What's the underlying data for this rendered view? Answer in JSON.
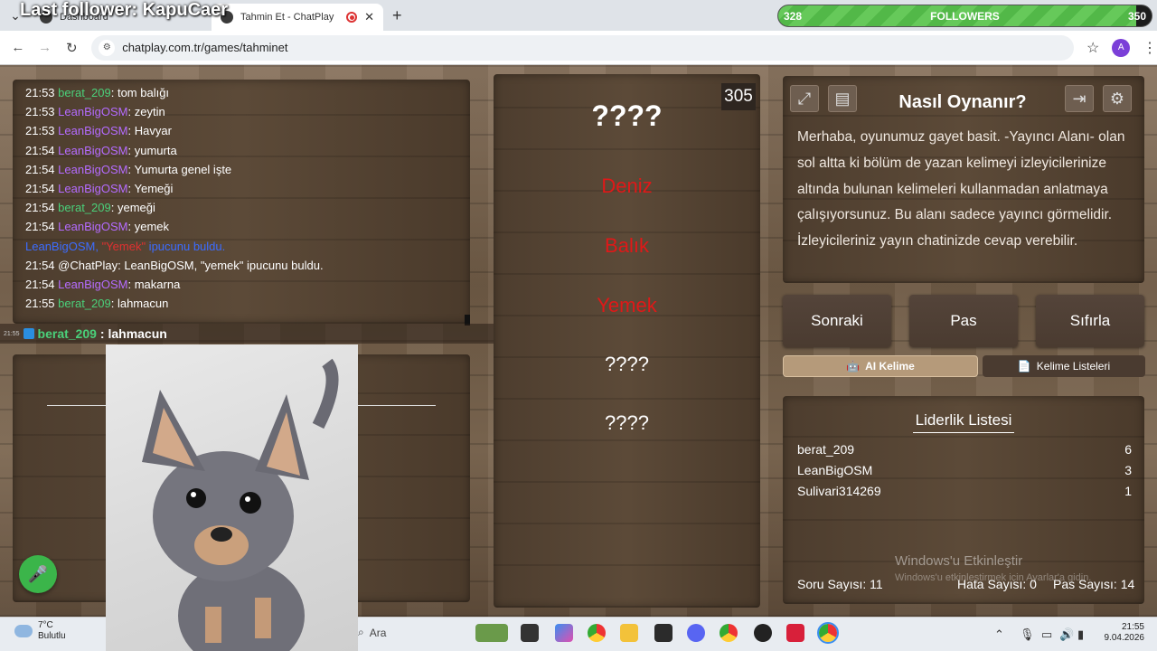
{
  "browser": {
    "tabs": [
      {
        "title": "Dashboard",
        "active": false
      },
      {
        "title": "Tahmin Et - ChatPlay",
        "active": true
      }
    ],
    "url": "chatplay.com.tr/games/tahminet",
    "profile_initial": "A"
  },
  "stream_overlay": {
    "last_follower": "Last follower: KapuCaer",
    "followers_min": "328",
    "followers_label": "FOLLOWERS",
    "followers_max": "350",
    "followers_progress": 0.96
  },
  "chat": {
    "messages": [
      {
        "time": "21:53",
        "user": "berat_209",
        "color": "green",
        "text": ": tom balığı"
      },
      {
        "time": "21:53",
        "user": "LeanBigOSM",
        "color": "purple",
        "text": ": zeytin"
      },
      {
        "time": "21:53",
        "user": "LeanBigOSM",
        "color": "purple",
        "text": ": Havyar"
      },
      {
        "time": "21:54",
        "user": "LeanBigOSM",
        "color": "purple",
        "text": ": yumurta"
      },
      {
        "time": "21:54",
        "user": "LeanBigOSM",
        "color": "purple",
        "text": ": Yumurta genel işte"
      },
      {
        "time": "21:54",
        "user": "LeanBigOSM",
        "color": "purple",
        "text": ": Yemeği"
      },
      {
        "time": "21:54",
        "user": "berat_209",
        "color": "green",
        "text": ": yemeği"
      },
      {
        "time": "21:54",
        "user": "LeanBigOSM",
        "color": "purple",
        "text": ": yemek"
      }
    ],
    "system_line": {
      "user": "LeanBigOSM",
      "word": "\"Yemek\"",
      "rest": " ipucunu buldu."
    },
    "bot_line": "21:54 @ChatPlay: LeanBigOSM, \"yemek\" ipucunu buldu.",
    "after": [
      {
        "time": "21:54",
        "user": "LeanBigOSM",
        "color": "purple",
        "text": ": makarna"
      },
      {
        "time": "21:55",
        "user": "berat_209",
        "color": "green",
        "text": ": lahmacun"
      }
    ]
  },
  "overlay_chat": {
    "time": "21:55",
    "user": "berat_209",
    "message": ": lahmacun"
  },
  "game": {
    "timer": "305",
    "target": "????",
    "clues": [
      {
        "text": "Deniz",
        "revealed": true
      },
      {
        "text": "Balık",
        "revealed": true
      },
      {
        "text": "Yemek",
        "revealed": true
      },
      {
        "text": "????",
        "revealed": false
      },
      {
        "text": "????",
        "revealed": false
      }
    ]
  },
  "howto": {
    "title": "Nasıl Oynanır?",
    "text": "Merhaba, oyunumuz gayet basit. -Yayıncı Alanı- olan sol altta ki bölüm de yazan kelimeyi izleyicilerinize altında bulunan kelimeleri kullanmadan anlatmaya çalışıyorsunuz. Bu alanı sadece yayıncı görmelidir. İzleyicileriniz yayın chatinizde cevap verebilir.",
    "icons": [
      "fullscreen-icon",
      "document-icon",
      "exit-icon",
      "settings-icon"
    ]
  },
  "actions": {
    "next": "Sonraki",
    "pass": "Pas",
    "reset": "Sıfırla"
  },
  "tabs": {
    "ai": "AI Kelime",
    "lists": "Kelime Listeleri"
  },
  "leaderboard": {
    "title": "Liderlik Listesi",
    "rows": [
      {
        "name": "berat_209",
        "score": "6"
      },
      {
        "name": "LeanBigOSM",
        "score": "3"
      },
      {
        "name": "Sulivari314269",
        "score": "1"
      }
    ],
    "stats": {
      "questions": "Soru Sayısı: 11",
      "errors": "Hata Sayısı: 0",
      "passes": "Pas Sayısı: 14"
    }
  },
  "watermark": {
    "title": "Windows'u Etkinleştir",
    "sub": "Windows'u etkinleştirmek için Ayarlar'a gidin."
  },
  "taskbar": {
    "weather_temp": "7°C",
    "weather_desc": "Bulutlu",
    "search": "Ara",
    "time": "21:55",
    "date": "9.04.2026"
  },
  "colors": {
    "green": "#4ad07a",
    "purple": "#b46bff",
    "clue_red": "#e01818",
    "system_blue": "#3c6cff"
  }
}
